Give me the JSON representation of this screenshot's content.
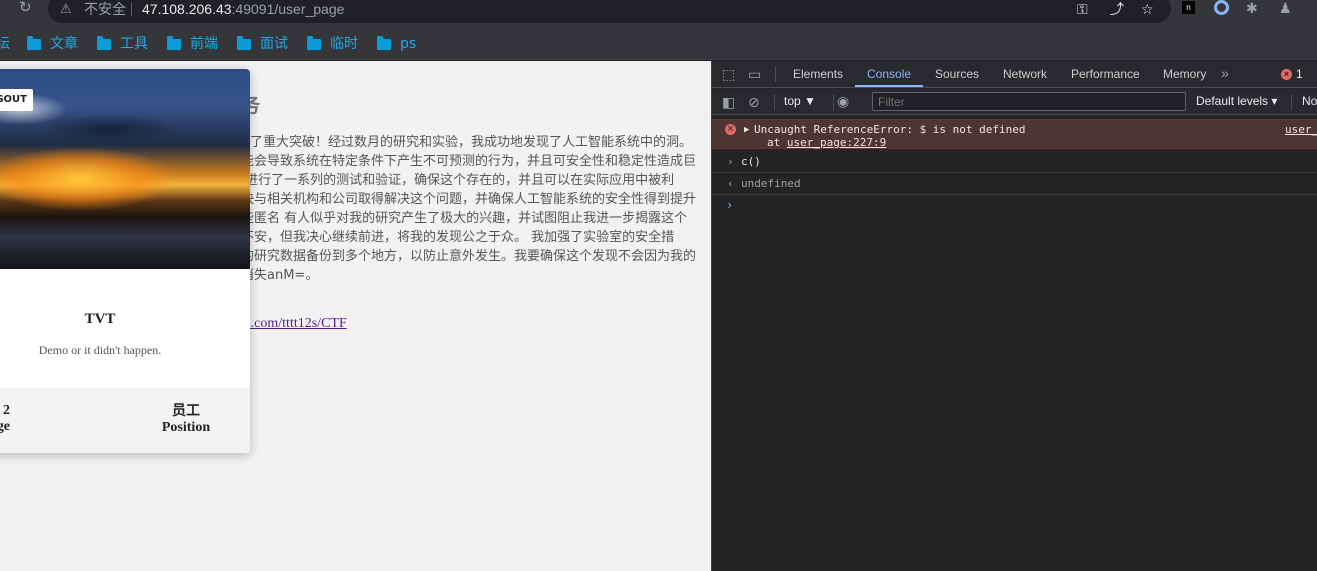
{
  "browser": {
    "insecure_label": "不安全",
    "url_host": "47.108.206.43",
    "url_rest": ":49091/user_page"
  },
  "bookmarks": [
    "坛",
    "文章",
    "工具",
    "前端",
    "面试",
    "临时",
    "ps"
  ],
  "page": {
    "logout_label": "GOUT",
    "title_partial": "务",
    "body_text": "了重大突破！经过数月的研究和实验，我成功地发现了人工智能系统中的洞。这个漏洞可能会导致系统在特定条件下产生不可预测的行为，并且可安全性和稳定性造成巨大威胁。 我进行了一系列的测试和验证，确保这个存在的，并且可以在实际应用中被利用。我将尽快与相关机构和公司取得解决这个问题，并确保人工智能系统的安全性得到提升 我收到了一些匿名 有人似乎对我的研究产生了极大的兴趣，并试图阻止我进一步揭露这个我感到有些不安，但我决心继续前进，将我的发现公之于众。 我加强了实验室的安全措施，并将我的研究数据备份到多个地方，以防止意外发生。我要确保这个发现不会因为我的离世而彻底消失anM=。",
    "link_text": "https://github.com/tttt12s/CTF",
    "card": {
      "name": "TVT",
      "motto": "Demo or it didn't happen.",
      "age_value": "2",
      "age_label": "ge",
      "position_value": "员工",
      "position_label": "Position"
    }
  },
  "devtools": {
    "tabs": [
      "Elements",
      "Console",
      "Sources",
      "Network",
      "Performance",
      "Memory"
    ],
    "active_tab": "Console",
    "error_count": "1",
    "context": "top",
    "filter_placeholder": "Filter",
    "levels_label": "Default levels",
    "issues_label": "No",
    "console": {
      "error_message": "Uncaught ReferenceError: $ is not defined",
      "error_at_prefix": "at ",
      "error_at_link": "user_page:227:9",
      "error_source": "user_",
      "input": "c()",
      "output": "undefined"
    }
  },
  "colors": {
    "accent": "#8ab4f8",
    "error": "#e46962",
    "bookmark": "#1eaae7"
  }
}
